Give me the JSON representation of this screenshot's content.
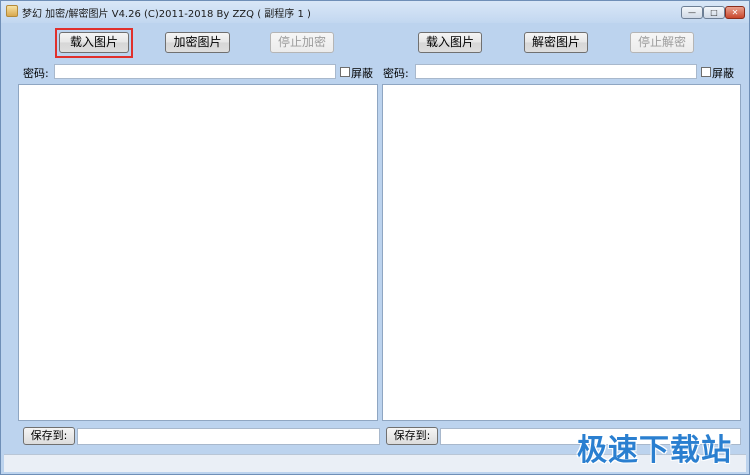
{
  "window": {
    "title": "梦幻 加密/解密图片 V4.26  (C)2011-2018 By ZZQ  ( 副程序 1 )",
    "controls": {
      "minimize": "—",
      "maximize": "□",
      "close": "✕"
    }
  },
  "left_panel": {
    "load_label": "载入图片",
    "encrypt_label": "加密图片",
    "stop_label": "停止加密",
    "password_label": "密码:",
    "password_value": "",
    "mask_label": "屏蔽",
    "save_label": "保存到:",
    "save_path": ""
  },
  "right_panel": {
    "load_label": "载入图片",
    "decrypt_label": "解密图片",
    "stop_label": "停止解密",
    "password_label": "密码:",
    "password_value": "",
    "mask_label": "屏蔽",
    "save_label": "保存到:",
    "save_path": ""
  },
  "watermark": "极速下载站",
  "colors": {
    "focus_highlight": "#e0302c",
    "watermark": "#2a7fd0",
    "window_bg": "#bcd3ee"
  }
}
